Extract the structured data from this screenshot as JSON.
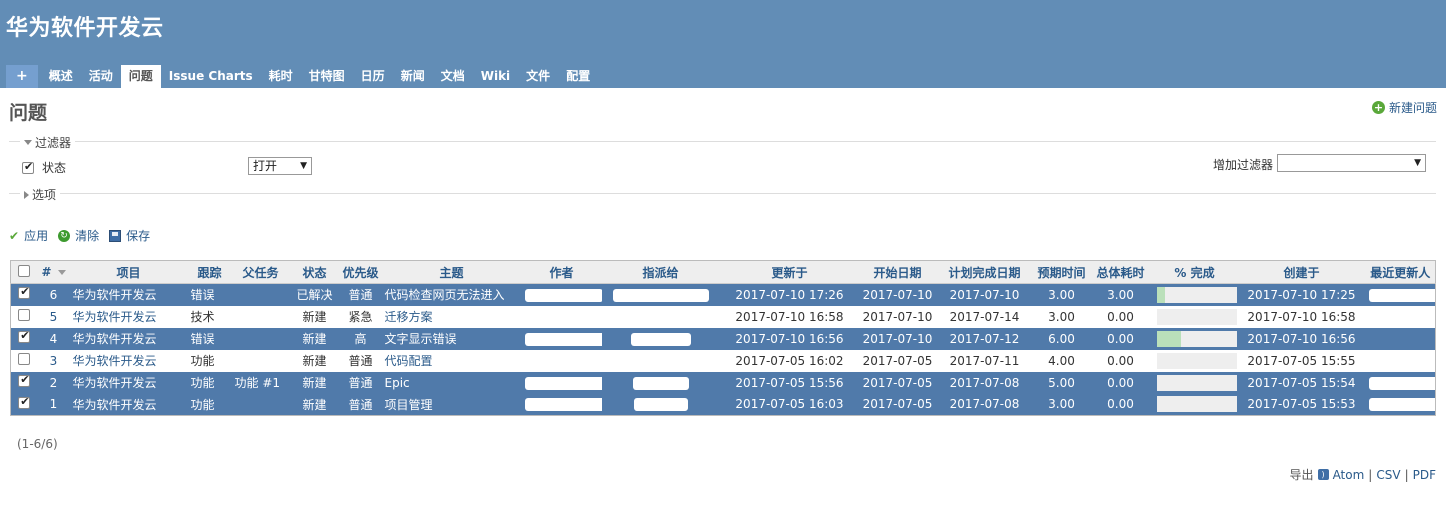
{
  "header": {
    "site_title": "华为软件开发云",
    "tabs": [
      {
        "label": "+"
      },
      {
        "label": "概述"
      },
      {
        "label": "活动"
      },
      {
        "label": "问题",
        "selected": true
      },
      {
        "label": "Issue Charts"
      },
      {
        "label": "耗时"
      },
      {
        "label": "甘特图"
      },
      {
        "label": "日历"
      },
      {
        "label": "新闻"
      },
      {
        "label": "文档"
      },
      {
        "label": "Wiki"
      },
      {
        "label": "文件"
      },
      {
        "label": "配置"
      }
    ]
  },
  "page": {
    "title": "问题",
    "new_issue": "新建问题"
  },
  "filters": {
    "legend": "过滤器",
    "status_label": "状态",
    "status_value": "打开",
    "add_filter_label": "增加过滤器",
    "add_filter_value": ""
  },
  "options": {
    "legend": "选项"
  },
  "actions": {
    "apply": "应用",
    "clear": "清除",
    "save": "保存"
  },
  "table": {
    "columns": [
      "#",
      "项目",
      "跟踪",
      "父任务",
      "状态",
      "优先级",
      "主题",
      "作者",
      "指派给",
      "更新于",
      "开始日期",
      "计划完成日期",
      "预期时间",
      "总体耗时",
      "% 完成",
      "创建于",
      "最近更新人"
    ],
    "rows": [
      {
        "selected": true,
        "id": "6",
        "project": "华为软件开发云",
        "tracker": "错误",
        "parent": "",
        "status": "已解决",
        "priority": "普通",
        "subject": "代码检查网页无法进入",
        "updated": "2017-07-10 17:26",
        "start": "2017-07-10",
        "due": "2017-07-10",
        "estimated": "3.00",
        "spent": "3.00",
        "done_ratio": 0.1,
        "created": "2017-07-10 17:25"
      },
      {
        "selected": false,
        "id": "5",
        "project": "华为软件开发云",
        "tracker": "技术",
        "parent": "",
        "status": "新建",
        "priority": "紧急",
        "subject": "迁移方案",
        "updated": "2017-07-10 16:58",
        "start": "2017-07-10",
        "due": "2017-07-14",
        "estimated": "3.00",
        "spent": "0.00",
        "done_ratio": 0,
        "created": "2017-07-10 16:58"
      },
      {
        "selected": true,
        "id": "4",
        "project": "华为软件开发云",
        "tracker": "错误",
        "parent": "",
        "status": "新建",
        "priority": "高",
        "subject": "文字显示错误",
        "updated": "2017-07-10 16:56",
        "start": "2017-07-10",
        "due": "2017-07-12",
        "estimated": "6.00",
        "spent": "0.00",
        "done_ratio": 0.3,
        "created": "2017-07-10 16:56"
      },
      {
        "selected": false,
        "id": "3",
        "project": "华为软件开发云",
        "tracker": "功能",
        "parent": "",
        "status": "新建",
        "priority": "普通",
        "subject": "代码配置",
        "updated": "2017-07-05 16:02",
        "start": "2017-07-05",
        "due": "2017-07-11",
        "estimated": "4.00",
        "spent": "0.00",
        "done_ratio": 0,
        "created": "2017-07-05 15:55"
      },
      {
        "selected": true,
        "id": "2",
        "project": "华为软件开发云",
        "tracker": "功能",
        "parent": "功能 #1",
        "status": "新建",
        "priority": "普通",
        "subject": "Epic",
        "updated": "2017-07-05 15:56",
        "start": "2017-07-05",
        "due": "2017-07-08",
        "estimated": "5.00",
        "spent": "0.00",
        "done_ratio": 0,
        "created": "2017-07-05 15:54"
      },
      {
        "selected": true,
        "id": "1",
        "project": "华为软件开发云",
        "tracker": "功能",
        "parent": "",
        "status": "新建",
        "priority": "普通",
        "subject": "项目管理",
        "updated": "2017-07-05 16:03",
        "start": "2017-07-05",
        "due": "2017-07-08",
        "estimated": "3.00",
        "spent": "0.00",
        "done_ratio": 0,
        "created": "2017-07-05 15:53"
      }
    ]
  },
  "footer": {
    "count": "(1-6/6)",
    "export_label": "导出",
    "atom": "Atom",
    "csv": "CSV",
    "pdf": "PDF",
    "separator": "|"
  }
}
